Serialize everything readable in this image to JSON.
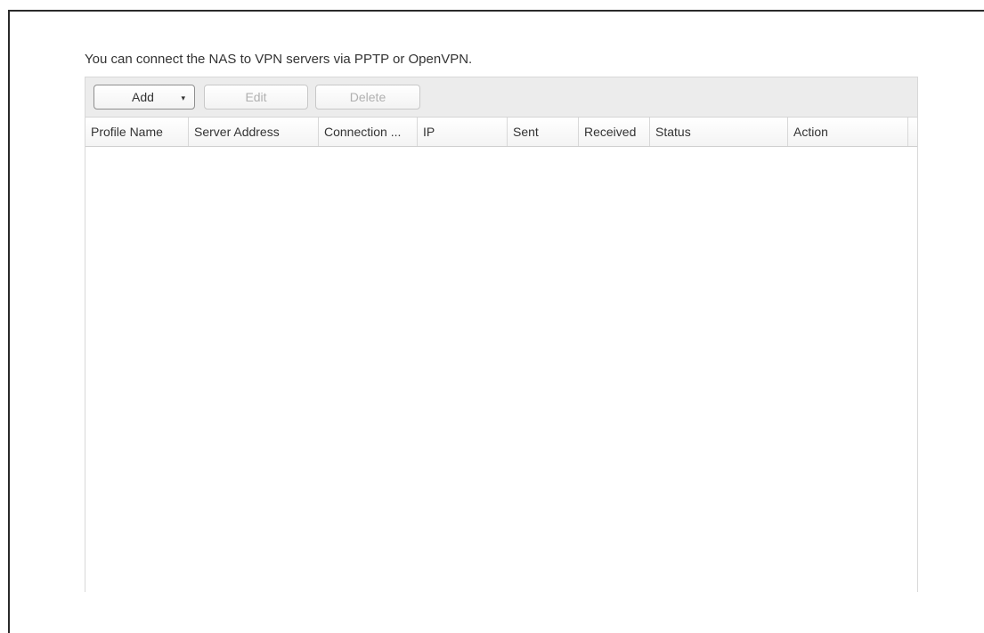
{
  "description": "You can connect the NAS to VPN servers via PPTP or OpenVPN.",
  "toolbar": {
    "add_label": "Add",
    "add_caret": "▾",
    "edit_label": "Edit",
    "delete_label": "Delete"
  },
  "table": {
    "columns": [
      "Profile Name",
      "Server Address",
      "Connection ...",
      "IP",
      "Sent",
      "Received",
      "Status",
      "Action",
      ""
    ],
    "rows": []
  }
}
